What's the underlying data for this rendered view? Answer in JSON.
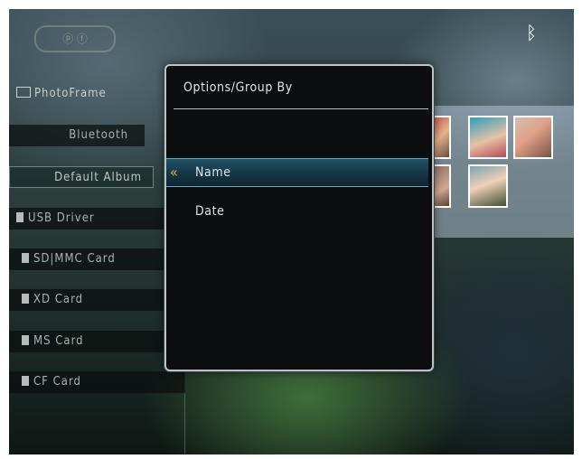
{
  "status": {
    "logo_icon": "photoframe-logo-icon",
    "bluetooth_icon": "bluetooth-icon"
  },
  "sidebar": {
    "items": [
      {
        "label": "PhotoFrame",
        "icon": "photoframe-icon"
      },
      {
        "label": "Bluetooth"
      },
      {
        "label": "Default Album",
        "selected": true
      },
      {
        "label": "USB Driver",
        "icon": "usb-icon"
      },
      {
        "label": "SD|MMC Card",
        "icon": "card-icon"
      },
      {
        "label": "XD Card",
        "icon": "card-icon"
      },
      {
        "label": "MS Card",
        "icon": "card-icon"
      },
      {
        "label": "CF Card",
        "icon": "card-icon"
      }
    ]
  },
  "dialog": {
    "title": "Options/Group By",
    "options": [
      {
        "label": "Name",
        "highlighted": true
      },
      {
        "label": "Date",
        "highlighted": false
      }
    ]
  },
  "colors": {
    "highlight": "#1f5468",
    "highlight_border": "#6aa7c0",
    "chevron": "#d8b84a"
  }
}
